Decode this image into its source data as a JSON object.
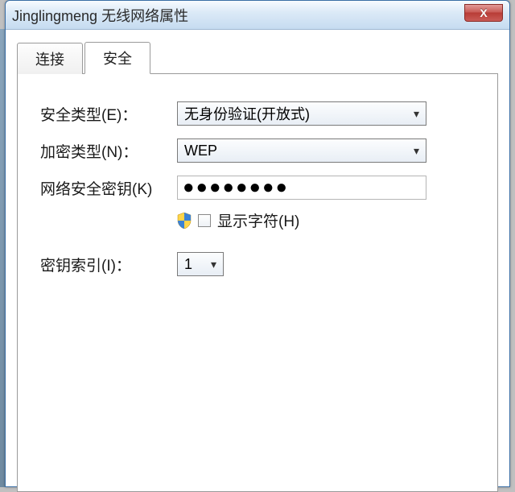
{
  "window": {
    "title": "Jinglingmeng 无线网络属性",
    "close_glyph": "X"
  },
  "tabs": {
    "connect": "连接",
    "security": "安全"
  },
  "form": {
    "security_type_label": "安全类型(E)：",
    "security_type_value": "无身份验证(开放式)",
    "encryption_label": "加密类型(N)：",
    "encryption_value": "WEP",
    "key_label": "网络安全密钥(K)",
    "key_value_masked": "●●●●●●●●",
    "show_chars_label": "显示字符(H)",
    "key_index_label": "密钥索引(I)：",
    "key_index_value": "1"
  }
}
